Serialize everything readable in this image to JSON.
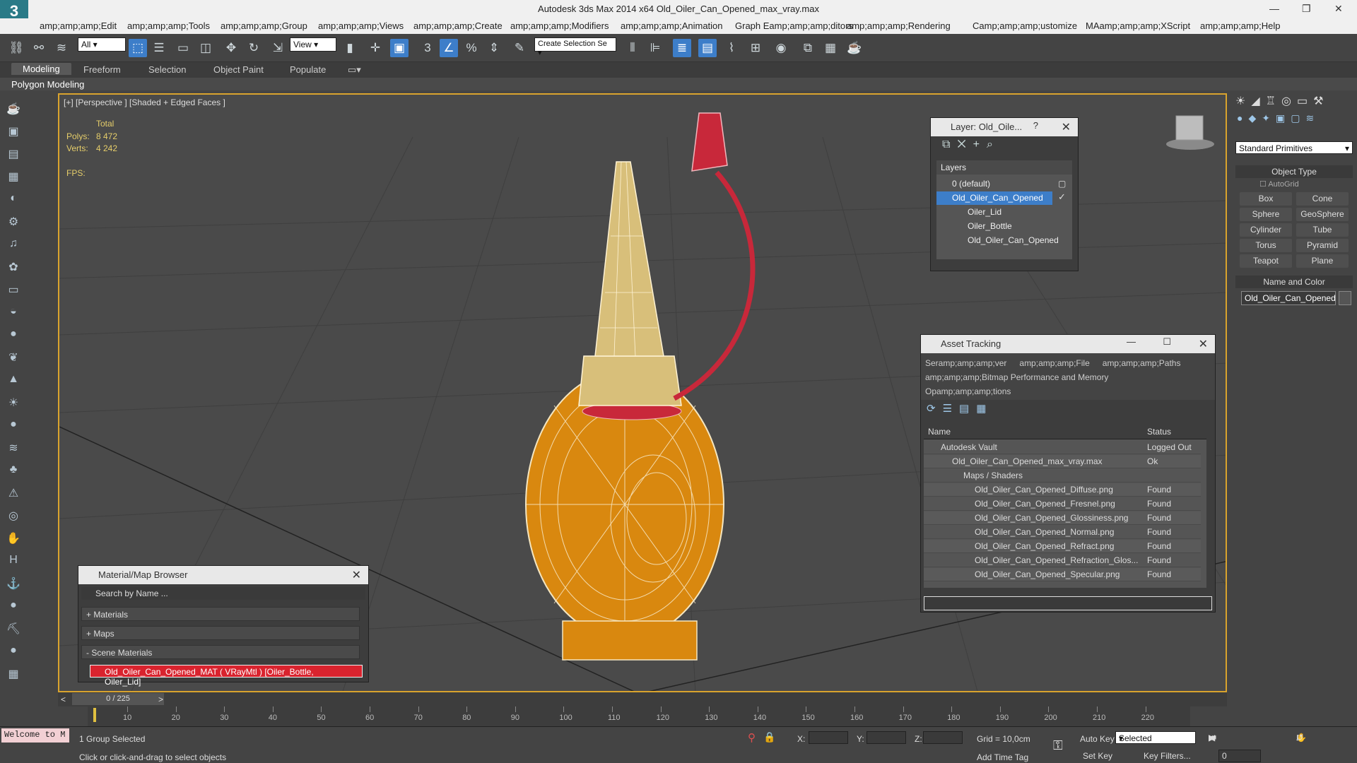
{
  "app": {
    "title": "Autodesk 3ds Max  2014 x64    Old_Oiler_Can_Opened_max_vray.max",
    "logo": "3"
  },
  "menu": [
    "amp;amp;amp;Edit",
    "amp;amp;amp;Tools",
    "amp;amp;amp;Group",
    "amp;amp;amp;Views",
    "amp;amp;amp;Create",
    "amp;amp;amp;Modifiers",
    "amp;amp;amp;Animation",
    "Graph Eamp;amp;amp;ditors",
    "amp;amp;amp;Rendering",
    "Camp;amp;amp;ustomize",
    "MAamp;amp;amp;XScript",
    "amp;amp;amp;Help"
  ],
  "toolbar": {
    "filter": "All",
    "refcoord": "View",
    "selset": "Create Selection Se"
  },
  "ribbon": {
    "tabs": [
      "Modeling",
      "Freeform",
      "Selection",
      "Object Paint",
      "Populate"
    ],
    "sub": "Polygon Modeling"
  },
  "viewport": {
    "label": "[+] [Perspective ] [Shaded + Edged Faces ]",
    "total": "Total",
    "polys_label": "Polys:",
    "polys": "8 472",
    "verts_label": "Verts:",
    "verts": "4 242",
    "fps": "FPS:"
  },
  "layer": {
    "title": "Layer: Old_Oile...",
    "help": "?",
    "header": "Layers",
    "items": [
      "0 (default)",
      "Old_Oiler_Can_Opened",
      "Oiler_Lid",
      "Oiler_Bottle",
      "Old_Oiler_Can_Opened"
    ]
  },
  "asset": {
    "title": "Asset Tracking",
    "menu1": [
      "Seramp;amp;amp;ver",
      "amp;amp;amp;File",
      "amp;amp;amp;Paths"
    ],
    "menu2": "amp;amp;amp;Bitmap Performance and Memory",
    "menu3": "Opamp;amp;amp;tions",
    "col_name": "Name",
    "col_status": "Status",
    "rows": [
      {
        "name": "Autodesk Vault",
        "status": "Logged Out ..."
      },
      {
        "name": "Old_Oiler_Can_Opened_max_vray.max",
        "status": "Ok"
      },
      {
        "name": "Maps / Shaders",
        "status": ""
      },
      {
        "name": "Old_Oiler_Can_Opened_Diffuse.png",
        "status": "Found"
      },
      {
        "name": "Old_Oiler_Can_Opened_Fresnel.png",
        "status": "Found"
      },
      {
        "name": "Old_Oiler_Can_Opened_Glossiness.png",
        "status": "Found"
      },
      {
        "name": "Old_Oiler_Can_Opened_Normal.png",
        "status": "Found"
      },
      {
        "name": "Old_Oiler_Can_Opened_Refract.png",
        "status": "Found"
      },
      {
        "name": "Old_Oiler_Can_Opened_Refraction_Glos...",
        "status": "Found"
      },
      {
        "name": "Old_Oiler_Can_Opened_Specular.png",
        "status": "Found"
      }
    ]
  },
  "material": {
    "title": "Material/Map Browser",
    "search_placeholder": "Search by Name ...",
    "sections": [
      "+ Materials",
      "+ Maps",
      "- Scene Materials"
    ],
    "scene_item": "Old_Oiler_Can_Opened_MAT  ( VRayMtl ) [Oiler_Bottle, Oiler_Lid]"
  },
  "cmdpanel": {
    "dropdown": "Standard Primitives",
    "object_type": "Object Type",
    "autogrid": "AutoGrid",
    "buttons": [
      "Box",
      "Cone",
      "Sphere",
      "GeoSphere",
      "Cylinder",
      "Tube",
      "Torus",
      "Pyramid",
      "Teapot",
      "Plane"
    ],
    "name_color": "Name and Color",
    "name_value": "Old_Oiler_Can_Opened"
  },
  "timeline": {
    "frame": "0 / 225",
    "ticks": [
      "10",
      "20",
      "30",
      "40",
      "50",
      "60",
      "70",
      "80",
      "90",
      "100",
      "110",
      "120",
      "130",
      "140",
      "150",
      "160",
      "170",
      "180",
      "190",
      "200",
      "210",
      "220"
    ]
  },
  "status": {
    "welcome": "Welcome to M",
    "selected": "1 Group Selected",
    "hint": "Click or click-and-drag to select objects",
    "x": "X:",
    "y": "Y:",
    "z": "Z:",
    "grid": "Grid = 10,0cm",
    "autokey": "Auto Key",
    "setkey": "Set Key",
    "selected_dd": "Selected",
    "keyfilters": "Key Filters...",
    "addtimetag": "Add Time Tag",
    "frame_field": "0"
  },
  "colors": {
    "accent": "#3d7ec9",
    "viewport_border": "#d9a32d",
    "bottle": "#d9880f",
    "spout": "#d8bf7a",
    "cap": "#c8283a",
    "selection_red": "#d9232e"
  }
}
